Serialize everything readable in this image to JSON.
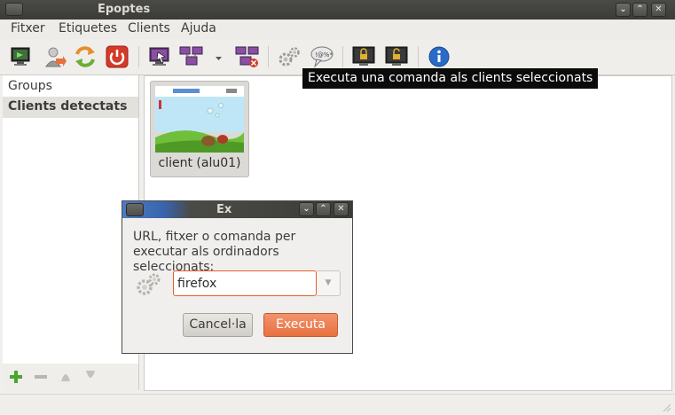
{
  "window": {
    "title": "Epoptes"
  },
  "menubar": {
    "items": [
      "Fitxer",
      "Etiquetes",
      "Clients",
      "Ajuda"
    ]
  },
  "tooltip": {
    "text": "Executa una comanda als clients seleccionats"
  },
  "sidebar": {
    "items": [
      {
        "label": "Groups"
      },
      {
        "label": "Clients detectats"
      }
    ]
  },
  "clients": [
    {
      "label": "client (alu01)"
    }
  ],
  "dialog": {
    "title": "Ex",
    "prompt": "URL, fitxer o comanda per executar als ordinadors seleccionats:",
    "input_value": "firefox",
    "cancel_label": "Cancel·la",
    "execute_label": "Executa"
  },
  "colors": {
    "accent": "#e7713f",
    "titlebar": "#3c3b37",
    "selection": "#e3e1dc",
    "tooltip_bg": "#0b0b0b"
  }
}
